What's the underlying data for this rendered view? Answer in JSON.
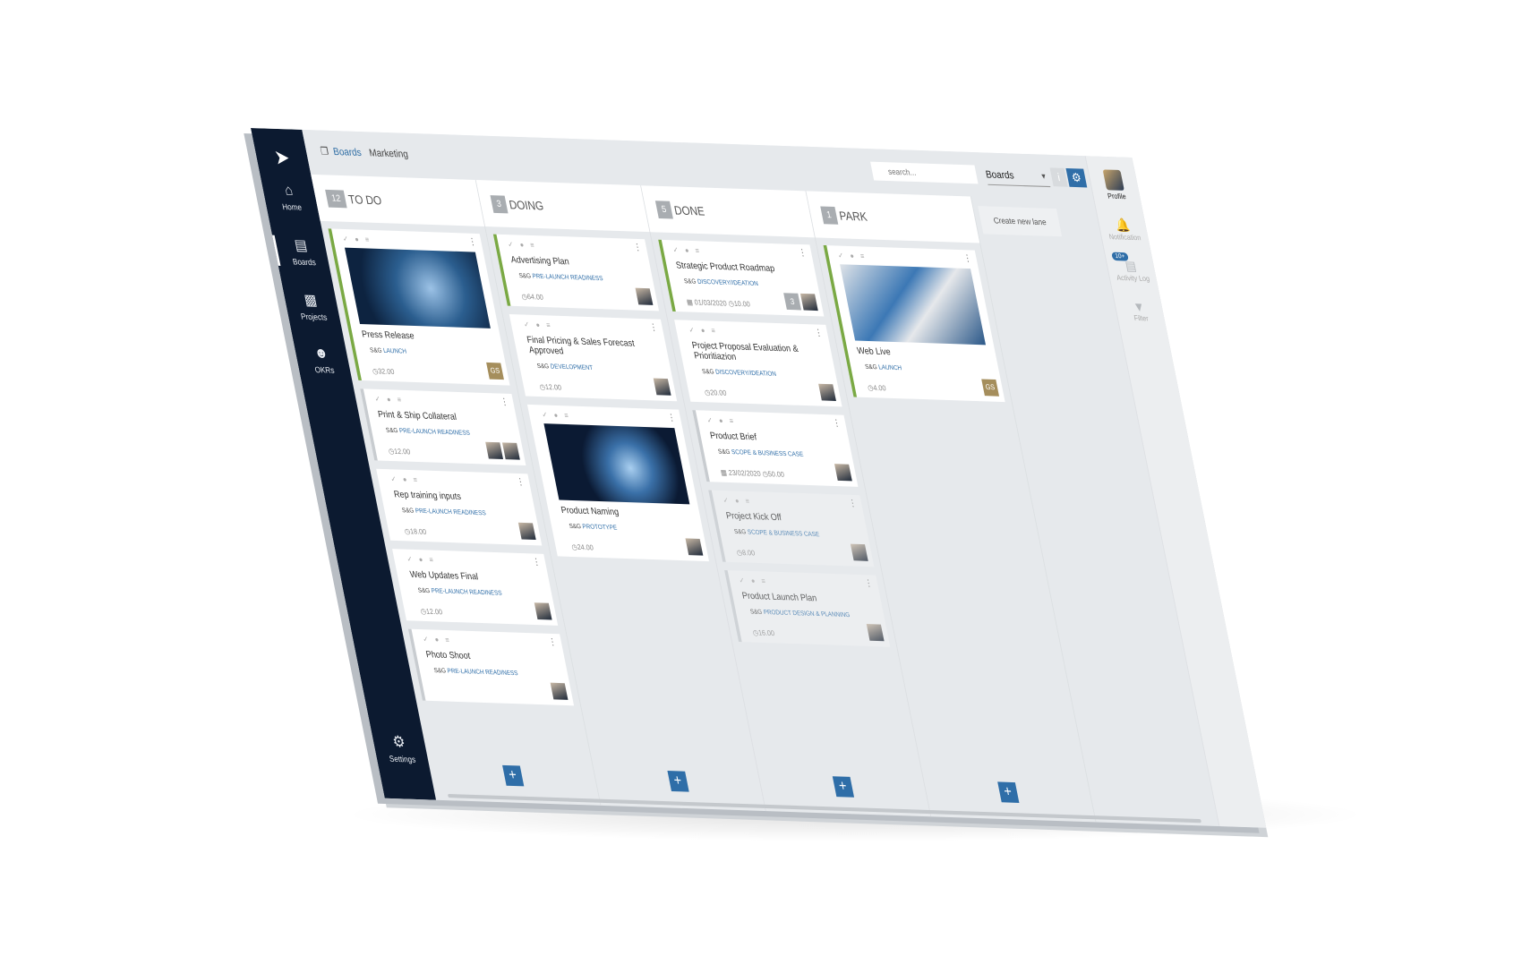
{
  "sidebar": {
    "items": [
      {
        "label": "Home",
        "icon": "home-icon"
      },
      {
        "label": "Boards",
        "icon": "boards-icon"
      },
      {
        "label": "Projects",
        "icon": "folder-icon"
      },
      {
        "label": "OKRs",
        "icon": "users-icon"
      }
    ],
    "settings": "Settings"
  },
  "breadcrumb": {
    "boards": "Boards",
    "current": "Marketing"
  },
  "toolbar": {
    "search_placeholder": "search...",
    "board_select": "Boards",
    "info": "i"
  },
  "rail": {
    "profile": "Profile",
    "notification": "Notification",
    "activity_badge": "10+",
    "activity": "Activity Log",
    "filter": "Filter"
  },
  "create_lane": "Create new lane",
  "colors": {
    "accent": "#2f6ea8",
    "sidebar": "#0c1a30",
    "green": "#7aa944"
  },
  "lanes": [
    {
      "count": "12",
      "name": "TO DO",
      "cards": [
        {
          "title": "Press Release",
          "prefix": "S&G",
          "tag": "LAUNCH",
          "time": "32.00",
          "image": "tech",
          "bar": "green",
          "avatars": [
            "GS"
          ]
        },
        {
          "title": "Print & Ship Collateral",
          "prefix": "S&G",
          "tag": "PRE-LAUNCH READINESS",
          "time": "12.00",
          "bar": "grey",
          "avatars": [
            "",
            ""
          ]
        },
        {
          "title": "Rep training inputs",
          "prefix": "S&G",
          "tag": "PRE-LAUNCH READINESS",
          "time": "18.00",
          "avatars": [
            ""
          ]
        },
        {
          "title": "Web Updates Final",
          "prefix": "S&G",
          "tag": "PRE-LAUNCH READINESS",
          "time": "12.00",
          "avatars": [
            ""
          ]
        },
        {
          "title": "Photo Shoot",
          "prefix": "S&G",
          "tag": "PRE-LAUNCH READINESS",
          "bar": "grey",
          "avatars": [
            ""
          ]
        }
      ]
    },
    {
      "count": "3",
      "name": "DOING",
      "cards": [
        {
          "title": "Advertising Plan",
          "prefix": "S&G",
          "tag": "PRE-LAUNCH READINESS",
          "time": "64.00",
          "bar": "green",
          "avatars": [
            ""
          ]
        },
        {
          "title": "Final Pricing & Sales Forecast Approved",
          "prefix": "S&G",
          "tag": "DEVELOPMENT",
          "time": "12.00",
          "avatars": [
            ""
          ]
        },
        {
          "title": "Product Naming",
          "prefix": "S&G",
          "tag": "PROTOTYPE",
          "time": "24.00",
          "image": "butterfly",
          "avatars": [
            ""
          ]
        }
      ]
    },
    {
      "count": "5",
      "name": "DONE",
      "cards": [
        {
          "title": "Strategic Product Roadmap",
          "prefix": "S&G",
          "tag": "DISCOVERY/IDEATION",
          "date": "01/03/2020",
          "time": "10.00",
          "bar": "green",
          "avatars": [
            "3",
            ""
          ]
        },
        {
          "title": "Project Proposal Evaluation & Prioritiazion",
          "prefix": "S&G",
          "tag": "DISCOVERY/IDEATION",
          "time": "20.00",
          "avatars": [
            ""
          ]
        },
        {
          "title": "Product Brief",
          "prefix": "S&G",
          "tag": "SCOPE & BUSINESS CASE",
          "date": "23/02/2020",
          "time": "50.00",
          "bar": "grey",
          "avatars": [
            ""
          ]
        },
        {
          "title": "Project Kick Off",
          "prefix": "S&G",
          "tag": "SCOPE & BUSINESS CASE",
          "time": "8.00",
          "bar": "grey",
          "faded": true,
          "avatars": [
            ""
          ]
        },
        {
          "title": "Product Launch Plan",
          "prefix": "S&G",
          "tag": "PRODUCT DESIGN & PLANNING",
          "time": "16.00",
          "bar": "grey",
          "faded": true,
          "avatars": [
            ""
          ]
        }
      ]
    },
    {
      "count": "1",
      "name": "PARK",
      "cards": [
        {
          "title": "Web Live",
          "prefix": "S&G",
          "tag": "LAUNCH",
          "time": "4.00",
          "image": "devices",
          "bar": "green",
          "avatars": [
            "GS"
          ]
        }
      ]
    }
  ]
}
